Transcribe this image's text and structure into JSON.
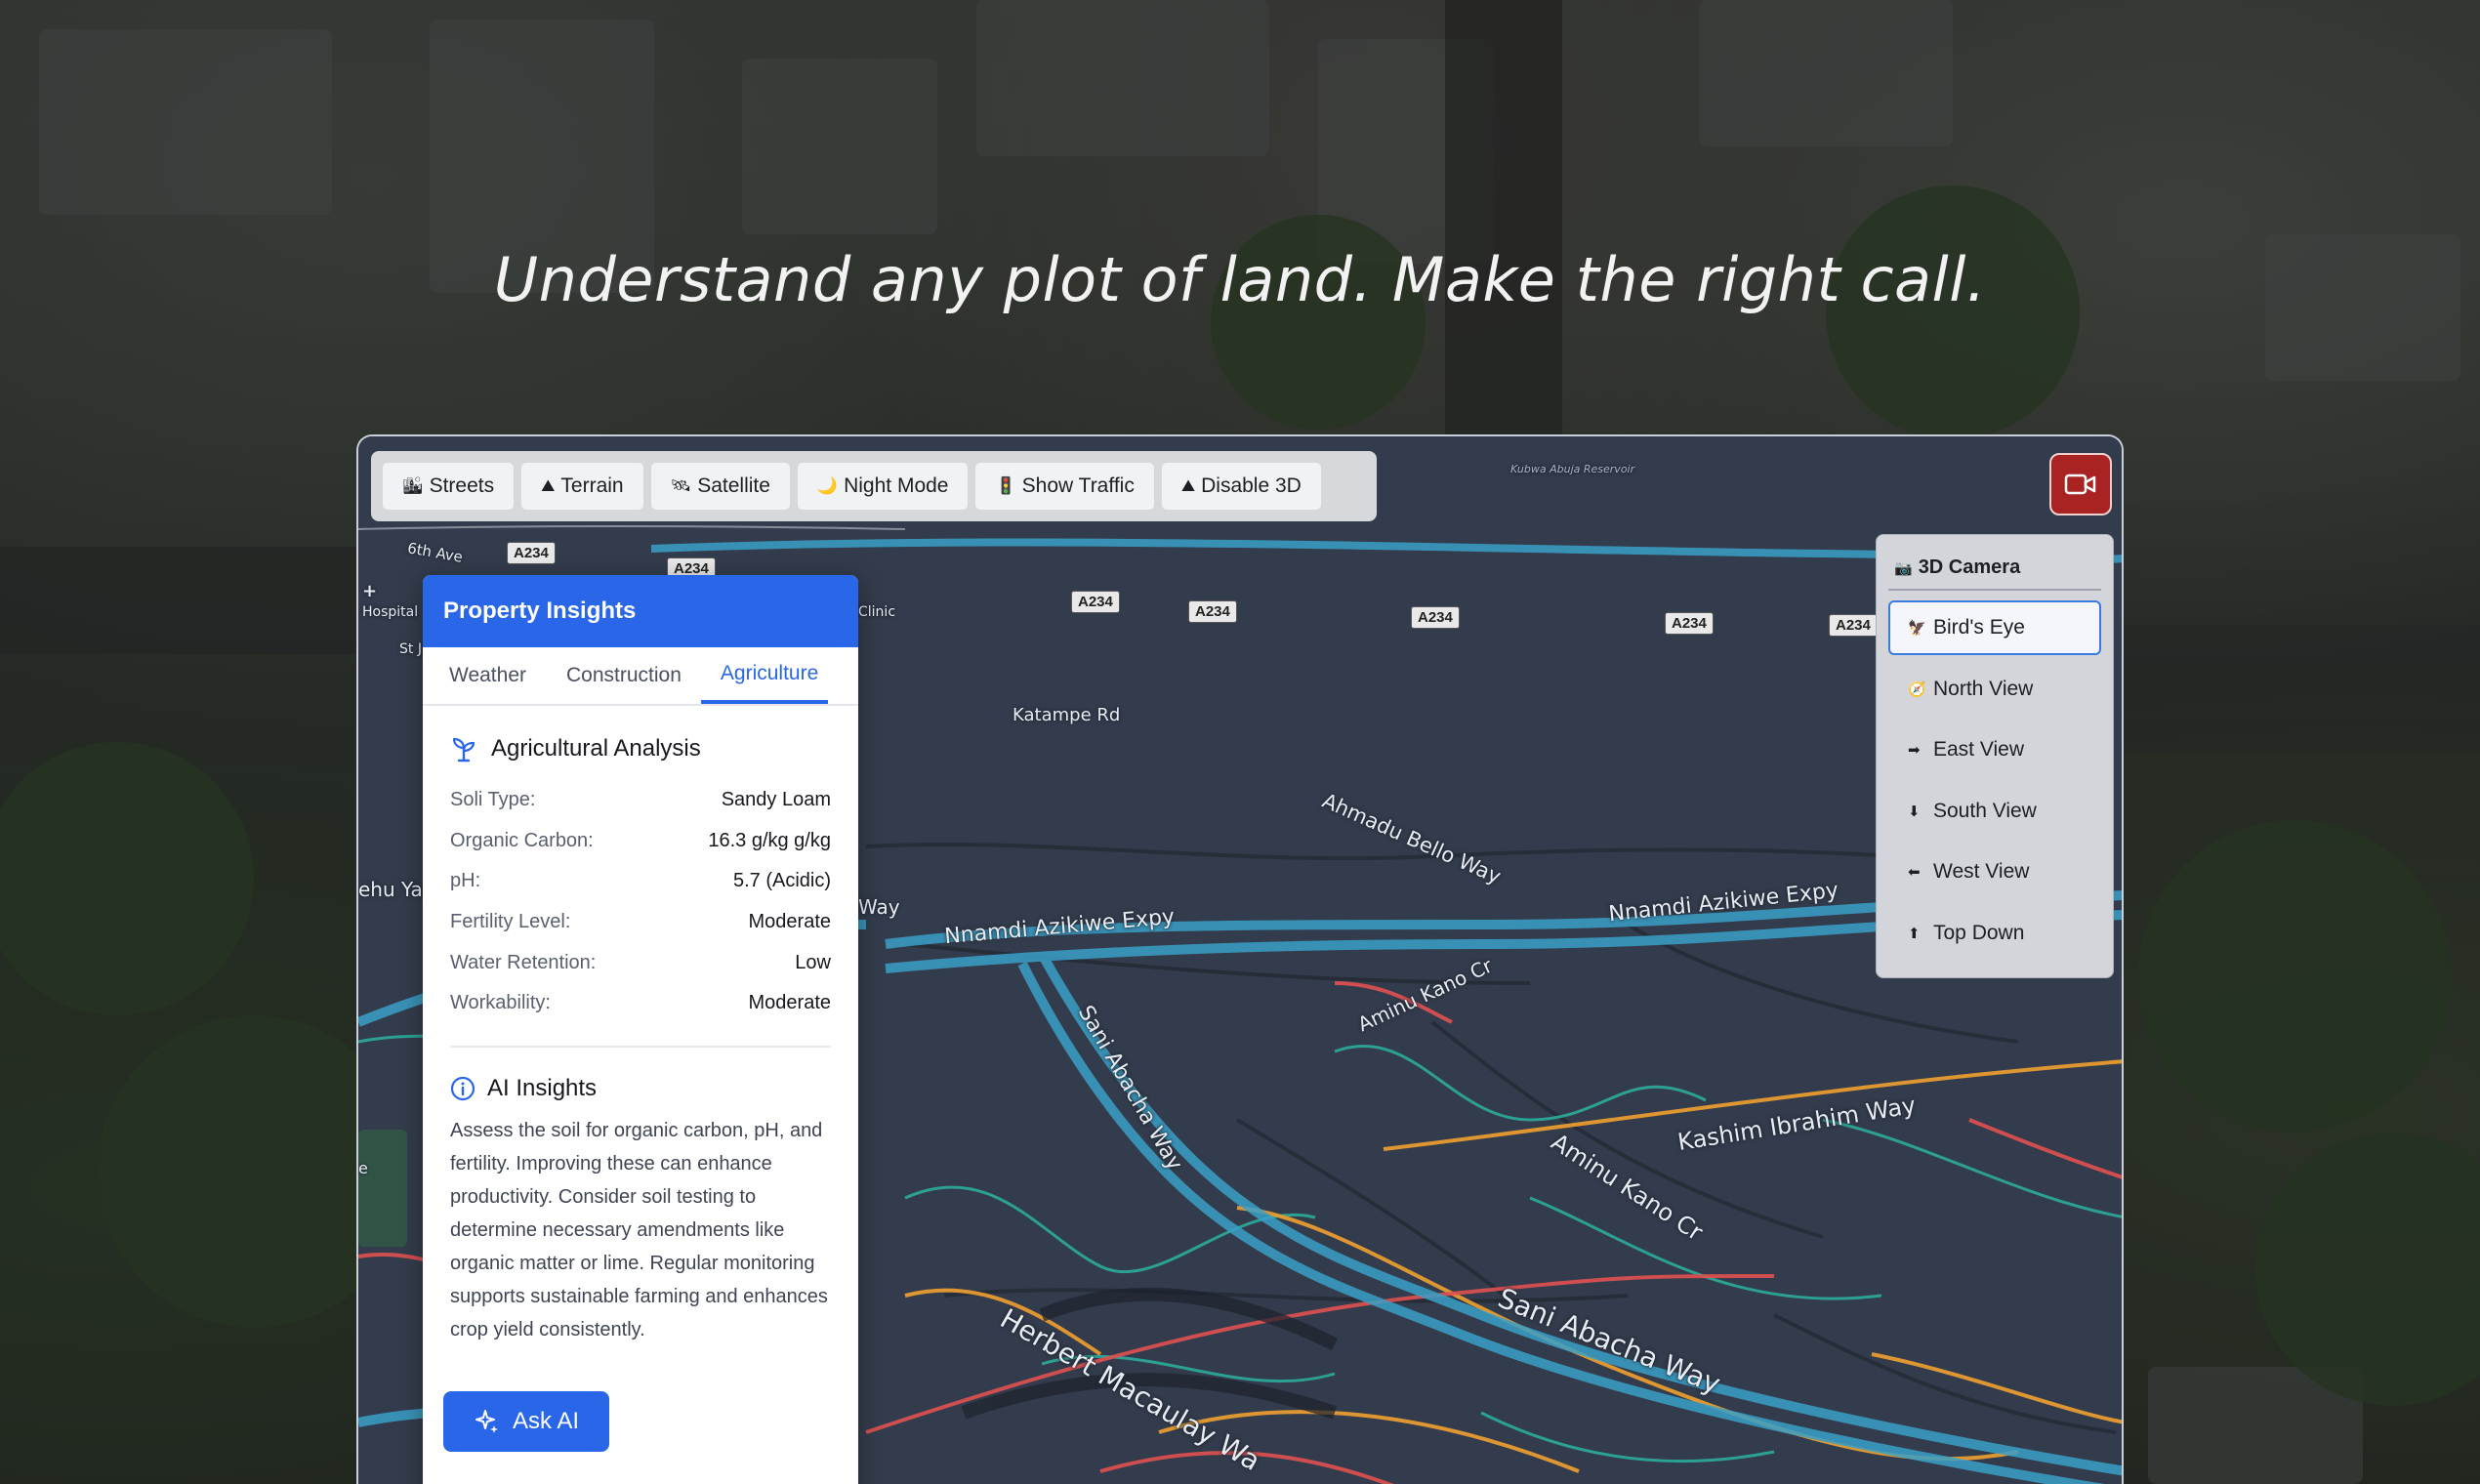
{
  "headline": "Understand any plot of land. Make the right call.",
  "toolbar": {
    "buttons": [
      {
        "icon": "🏙",
        "label": "Streets"
      },
      {
        "icon": "⛰",
        "label": "Terrain"
      },
      {
        "icon": "🛰",
        "label": "Satellite"
      },
      {
        "icon": "🌙",
        "label": "Night Mode"
      },
      {
        "icon": "🚦",
        "label": "Show Traffic"
      },
      {
        "icon": "⛰",
        "label": "Disable 3D"
      }
    ]
  },
  "camera": {
    "title": "3D Camera",
    "title_icon": "📷",
    "items": [
      {
        "icon": "🦅",
        "label": "Bird's Eye",
        "active": true
      },
      {
        "icon": "🧭",
        "label": "North View"
      },
      {
        "icon": "➡",
        "label": "East View"
      },
      {
        "icon": "⬇",
        "label": "South View"
      },
      {
        "icon": "⬅",
        "label": "West View"
      },
      {
        "icon": "⬆",
        "label": "Top Down"
      }
    ]
  },
  "insights": {
    "title": "Property Insights",
    "tabs": [
      "Weather",
      "Construction",
      "Agriculture"
    ],
    "active_tab": "Agriculture",
    "section_title": "Agricultural Analysis",
    "rows": [
      {
        "k": "Soli Type:",
        "v": "Sandy Loam"
      },
      {
        "k": "Organic Carbon:",
        "v": "16.3 g/kg g/kg"
      },
      {
        "k": "pH:",
        "v": "5.7 (Acidic)"
      },
      {
        "k": "Fertility Level:",
        "v": "Moderate"
      },
      {
        "k": "Water Retention:",
        "v": "Low"
      },
      {
        "k": "Workability:",
        "v": "Moderate"
      }
    ],
    "ai_title": "AI Insights",
    "ai_text": "Assess the soil for organic carbon, pH, and fertility. Improving these can enhance productivity. Consider soil testing to determine necessary amendments like organic matter or lime. Regular monitoring supports sustainable farming and enhances crop yield consistently.",
    "ask_label": "Ask AI"
  },
  "map": {
    "roads": {
      "katampe": "Katampe Rd",
      "ahmadu": "Ahmadu Bello Way",
      "nnamdi_left": "Nnamdi Azikiwe Expy",
      "nnamdi_right": "Nnamdi Azikiwe Expy",
      "aminu_top": "Aminu Kano Cr",
      "aminu_bottom": "Aminu Kano Cr",
      "sani_left": "Sani Abacha Way",
      "sani_right": "Sani Abacha Way",
      "kashim": "Kashim Ibrahim Way",
      "herbert": "Herbert Macaulay Wa",
      "way": "Way",
      "sixth": "6th Ave",
      "hospital": "Hospital",
      "clinic": "Clinic",
      "ehu": "ehu Ya",
      "st": "St J",
      "reservoir": "Kubwa Abuja Reservoir",
      "e_edge": "e"
    },
    "shields": [
      "A234",
      "A234",
      "A234",
      "A234",
      "A234",
      "A234",
      "A234"
    ],
    "colors": {
      "base": "#333c4c",
      "primary": "#3aa0c8",
      "secondary": "#2bb3a0",
      "arterial": "#f0a030",
      "alert": "#e05050"
    }
  }
}
